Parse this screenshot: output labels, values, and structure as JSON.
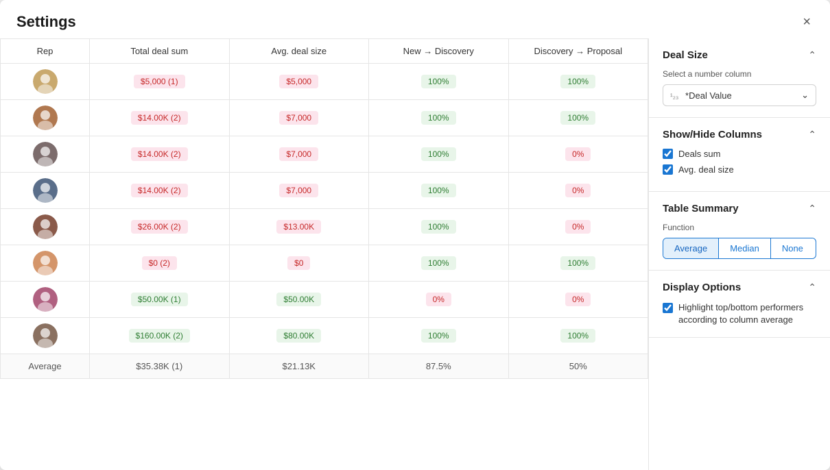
{
  "modal": {
    "title": "Settings",
    "close_label": "×"
  },
  "table": {
    "columns": [
      "Rep",
      "Total deal sum",
      "Avg. deal size",
      "New → Discovery",
      "Discovery → Proposal"
    ],
    "rows": [
      {
        "avatar_seed": 1,
        "total_deal": "$5,000 (1)",
        "total_color": "pink",
        "avg_deal": "$5,000",
        "avg_color": "pink",
        "new_disc": "100%",
        "new_disc_color": "green",
        "disc_prop": "100%",
        "disc_prop_color": "green"
      },
      {
        "avatar_seed": 2,
        "total_deal": "$14.00K (2)",
        "total_color": "pink",
        "avg_deal": "$7,000",
        "avg_color": "pink",
        "new_disc": "100%",
        "new_disc_color": "green",
        "disc_prop": "100%",
        "disc_prop_color": "green"
      },
      {
        "avatar_seed": 3,
        "total_deal": "$14.00K (2)",
        "total_color": "pink",
        "avg_deal": "$7,000",
        "avg_color": "pink",
        "new_disc": "100%",
        "new_disc_color": "green",
        "disc_prop": "0%",
        "disc_prop_color": "pink"
      },
      {
        "avatar_seed": 4,
        "total_deal": "$14.00K (2)",
        "total_color": "pink",
        "avg_deal": "$7,000",
        "avg_color": "pink",
        "new_disc": "100%",
        "new_disc_color": "green",
        "disc_prop": "0%",
        "disc_prop_color": "pink"
      },
      {
        "avatar_seed": 5,
        "total_deal": "$26.00K (2)",
        "total_color": "pink",
        "avg_deal": "$13.00K",
        "avg_color": "pink",
        "new_disc": "100%",
        "new_disc_color": "green",
        "disc_prop": "0%",
        "disc_prop_color": "pink"
      },
      {
        "avatar_seed": 6,
        "total_deal": "$0 (2)",
        "total_color": "pink",
        "avg_deal": "$0",
        "avg_color": "pink",
        "new_disc": "100%",
        "new_disc_color": "green",
        "disc_prop": "100%",
        "disc_prop_color": "green"
      },
      {
        "avatar_seed": 7,
        "total_deal": "$50.00K (1)",
        "total_color": "green",
        "avg_deal": "$50.00K",
        "avg_color": "green",
        "new_disc": "0%",
        "new_disc_color": "pink",
        "disc_prop": "0%",
        "disc_prop_color": "pink"
      },
      {
        "avatar_seed": 8,
        "total_deal": "$160.00K (2)",
        "total_color": "green",
        "avg_deal": "$80.00K",
        "avg_color": "green",
        "new_disc": "100%",
        "new_disc_color": "green",
        "disc_prop": "100%",
        "disc_prop_color": "green"
      }
    ],
    "footer": {
      "label": "Average",
      "total_deal": "$35.38K (1)",
      "avg_deal": "$21.13K",
      "new_disc": "87.5%",
      "disc_prop": "50%"
    }
  },
  "right_panel": {
    "deal_size": {
      "title": "Deal Size",
      "select_label": "Select a number column",
      "select_value": "*Deal Value",
      "select_num_icon": "¹₂₃"
    },
    "show_hide": {
      "title": "Show/Hide Columns",
      "columns": [
        {
          "label": "Deals sum",
          "checked": true
        },
        {
          "label": "Avg. deal size",
          "checked": true
        }
      ]
    },
    "table_summary": {
      "title": "Table Summary",
      "function_label": "Function",
      "buttons": [
        "Average",
        "Median",
        "None"
      ],
      "active_button": "Average"
    },
    "display_options": {
      "title": "Display Options",
      "highlight_label": "Highlight top/bottom performers according to column average",
      "highlight_checked": true
    }
  },
  "avatars": {
    "colors": [
      "#c9a96e",
      "#b07850",
      "#7c6c6c",
      "#5a6e8a",
      "#8a5a4a",
      "#d4956a",
      "#b06080",
      "#8a7060"
    ]
  }
}
